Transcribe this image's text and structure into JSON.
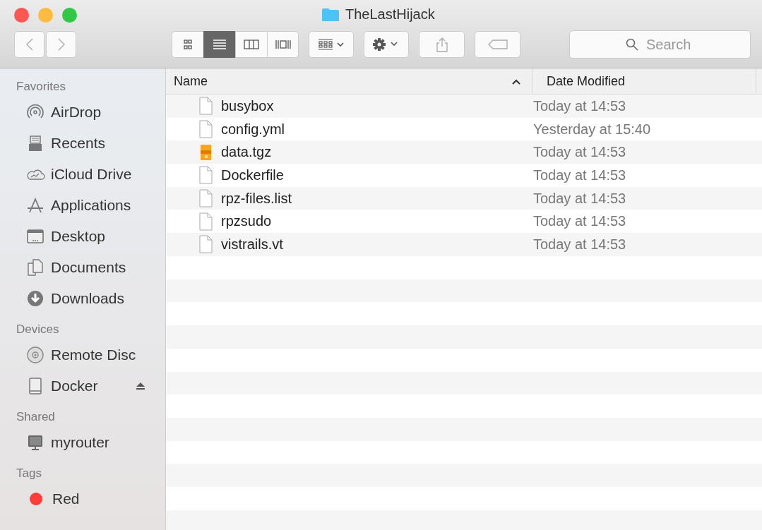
{
  "window": {
    "title": "TheLastHijack"
  },
  "toolbar": {
    "views": [
      {
        "kind": "icons",
        "selected": false
      },
      {
        "kind": "list",
        "selected": true
      },
      {
        "kind": "columns",
        "selected": false
      },
      {
        "kind": "coverflow",
        "selected": false
      }
    ],
    "search": {
      "placeholder": "Search"
    }
  },
  "sidebar": {
    "sections": [
      {
        "title": "Favorites",
        "items": [
          {
            "label": "AirDrop",
            "kind": "airdrop"
          },
          {
            "label": "Recents",
            "kind": "recents"
          },
          {
            "label": "iCloud Drive",
            "kind": "cloud"
          },
          {
            "label": "Applications",
            "kind": "apps"
          },
          {
            "label": "Desktop",
            "kind": "desktop"
          },
          {
            "label": "Documents",
            "kind": "documents"
          },
          {
            "label": "Downloads",
            "kind": "downloads"
          }
        ]
      },
      {
        "title": "Devices",
        "items": [
          {
            "label": "Remote Disc",
            "kind": "disc"
          },
          {
            "label": "Docker",
            "kind": "drive",
            "ejectable": true
          }
        ]
      },
      {
        "title": "Shared",
        "items": [
          {
            "label": "myrouter",
            "kind": "computer"
          }
        ]
      },
      {
        "title": "Tags",
        "items": [
          {
            "label": "Red",
            "kind": "tag",
            "color": "#fc3d39"
          }
        ]
      }
    ]
  },
  "table": {
    "columns": [
      {
        "label": "Name",
        "sorted": true
      },
      {
        "label": "Date Modified",
        "sorted": false
      }
    ],
    "rows": [
      {
        "name": "busybox",
        "kind": "document",
        "date": "Today at 14:53"
      },
      {
        "name": "config.yml",
        "kind": "document",
        "date": "Yesterday at 15:40"
      },
      {
        "name": "data.tgz",
        "kind": "archive",
        "date": "Today at 14:53"
      },
      {
        "name": "Dockerfile",
        "kind": "document",
        "date": "Today at 14:53"
      },
      {
        "name": "rpz-files.list",
        "kind": "document",
        "date": "Today at 14:53"
      },
      {
        "name": "rpzsudo",
        "kind": "document",
        "date": "Today at 14:53"
      },
      {
        "name": "vistrails.vt",
        "kind": "document",
        "date": "Today at 14:53"
      }
    ]
  }
}
